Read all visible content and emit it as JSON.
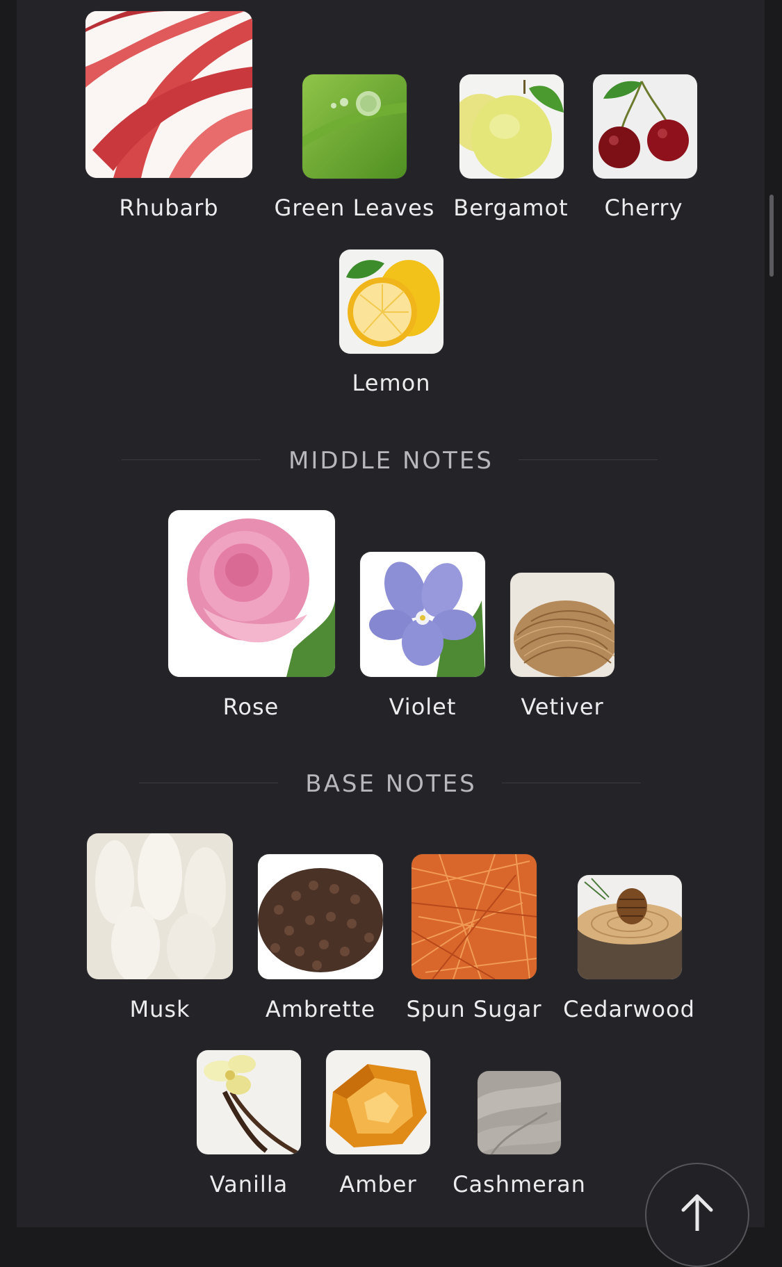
{
  "top_notes": {
    "items": [
      {
        "label": "Rhubarb",
        "icon": "rhubarb-image"
      },
      {
        "label": "Green Leaves",
        "icon": "green-leaves-image"
      },
      {
        "label": "Bergamot",
        "icon": "bergamot-image"
      },
      {
        "label": "Cherry",
        "icon": "cherry-image"
      },
      {
        "label": "Lemon",
        "icon": "lemon-image"
      }
    ]
  },
  "middle_notes": {
    "title": "MIDDLE NOTES",
    "items": [
      {
        "label": "Rose",
        "icon": "rose-image"
      },
      {
        "label": "Violet",
        "icon": "violet-image"
      },
      {
        "label": "Vetiver",
        "icon": "vetiver-image"
      }
    ]
  },
  "base_notes": {
    "title": "BASE NOTES",
    "items": [
      {
        "label": "Musk",
        "icon": "musk-image"
      },
      {
        "label": "Ambrette",
        "icon": "ambrette-image"
      },
      {
        "label": "Spun Sugar",
        "icon": "spun-sugar-image"
      },
      {
        "label": "Cedarwood",
        "icon": "cedarwood-image"
      },
      {
        "label": "Vanilla",
        "icon": "vanilla-image"
      },
      {
        "label": "Amber",
        "icon": "amber-image"
      },
      {
        "label": "Cashmeran",
        "icon": "cashmeran-image"
      }
    ]
  },
  "scroll_to_top": {
    "icon": "arrow-up-icon"
  },
  "colors": {
    "background": "#242428",
    "text": "#ececee",
    "section_title": "#b7b7bc"
  }
}
